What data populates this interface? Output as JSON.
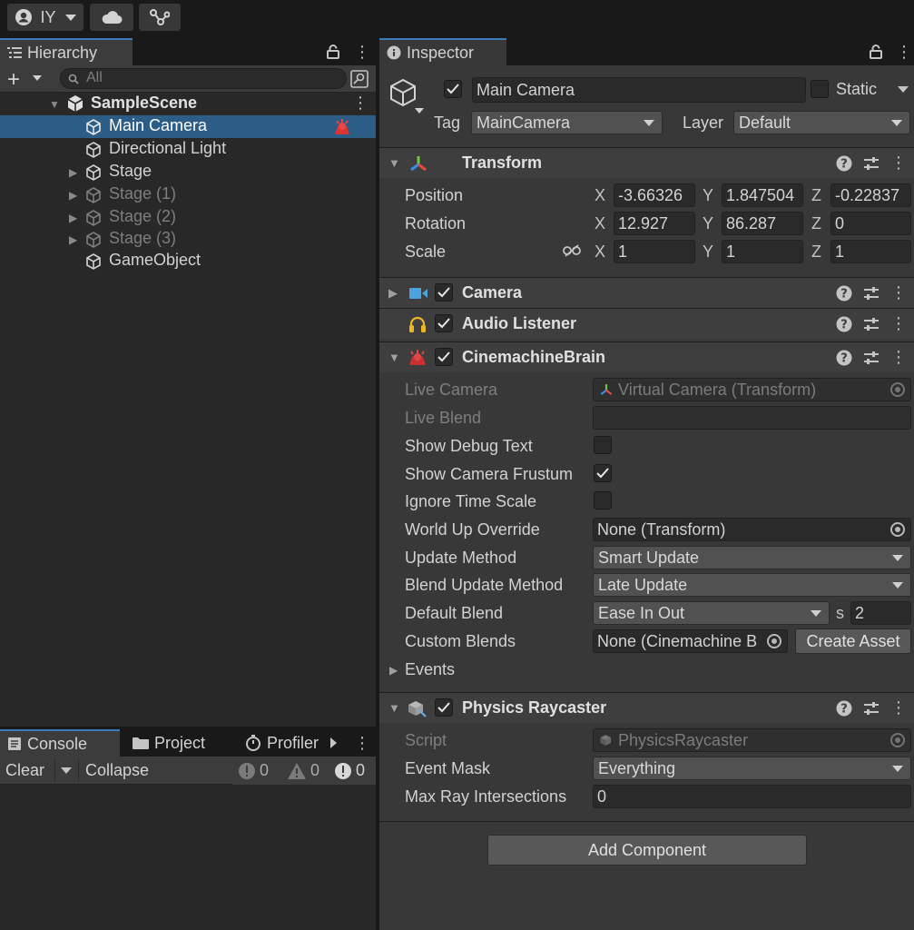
{
  "toolbar": {
    "account_label": "IY"
  },
  "hierarchy": {
    "tab_label": "Hierarchy",
    "search_placeholder": "All",
    "scene_name": "SampleScene",
    "items": [
      {
        "label": "Main Camera",
        "selected": true,
        "dim": false
      },
      {
        "label": "Directional Light",
        "selected": false,
        "dim": false
      },
      {
        "label": "Stage",
        "selected": false,
        "dim": false
      },
      {
        "label": "Stage (1)",
        "selected": false,
        "dim": true
      },
      {
        "label": "Stage (2)",
        "selected": false,
        "dim": true
      },
      {
        "label": "Stage (3)",
        "selected": false,
        "dim": true
      },
      {
        "label": "GameObject",
        "selected": false,
        "dim": false
      }
    ]
  },
  "console": {
    "tabs": [
      "Console",
      "Project",
      "Profiler"
    ],
    "clear_label": "Clear",
    "collapse_label": "Collapse",
    "log_count": "0",
    "warning_count": "0",
    "error_count": "0"
  },
  "inspector": {
    "tab_label": "Inspector",
    "object_name": "Main Camera",
    "static_label": "Static",
    "tag_label": "Tag",
    "tag_value": "MainCamera",
    "layer_label": "Layer",
    "layer_value": "Default",
    "transform": {
      "title": "Transform",
      "position_label": "Position",
      "rotation_label": "Rotation",
      "scale_label": "Scale",
      "position": {
        "x": "-3.66326",
        "y": "1.847504",
        "z": "-0.22837"
      },
      "rotation": {
        "x": "12.927",
        "y": "86.287",
        "z": "0"
      },
      "scale": {
        "x": "1",
        "y": "1",
        "z": "1"
      }
    },
    "camera": {
      "title": "Camera"
    },
    "audio_listener": {
      "title": "Audio Listener"
    },
    "brain": {
      "title": "CinemachineBrain",
      "live_camera_label": "Live Camera",
      "live_camera_value": "Virtual Camera (Transform)",
      "live_blend_label": "Live Blend",
      "show_debug_label": "Show Debug Text",
      "show_frustum_label": "Show Camera Frustum",
      "ignore_time_label": "Ignore Time Scale",
      "world_up_label": "World Up Override",
      "world_up_value": "None (Transform)",
      "update_method_label": "Update Method",
      "update_method_value": "Smart Update",
      "blend_update_label": "Blend Update Method",
      "blend_update_value": "Late Update",
      "default_blend_label": "Default Blend",
      "default_blend_value": "Ease In Out",
      "blend_s_label": "s",
      "blend_s_value": "2",
      "custom_blends_label": "Custom Blends",
      "custom_blends_value": "None (Cinemachine B",
      "create_asset_label": "Create Asset",
      "events_label": "Events"
    },
    "raycaster": {
      "title": "Physics Raycaster",
      "script_label": "Script",
      "script_value": "PhysicsRaycaster",
      "event_mask_label": "Event Mask",
      "event_mask_value": "Everything",
      "max_ray_label": "Max Ray Intersections",
      "max_ray_value": "0"
    },
    "add_component_label": "Add Component"
  },
  "colors": {
    "selection": "#2c5d87",
    "tab_accent": "#3a79bb",
    "panel_bg": "#383838",
    "hierarchy_bg": "#282828"
  }
}
